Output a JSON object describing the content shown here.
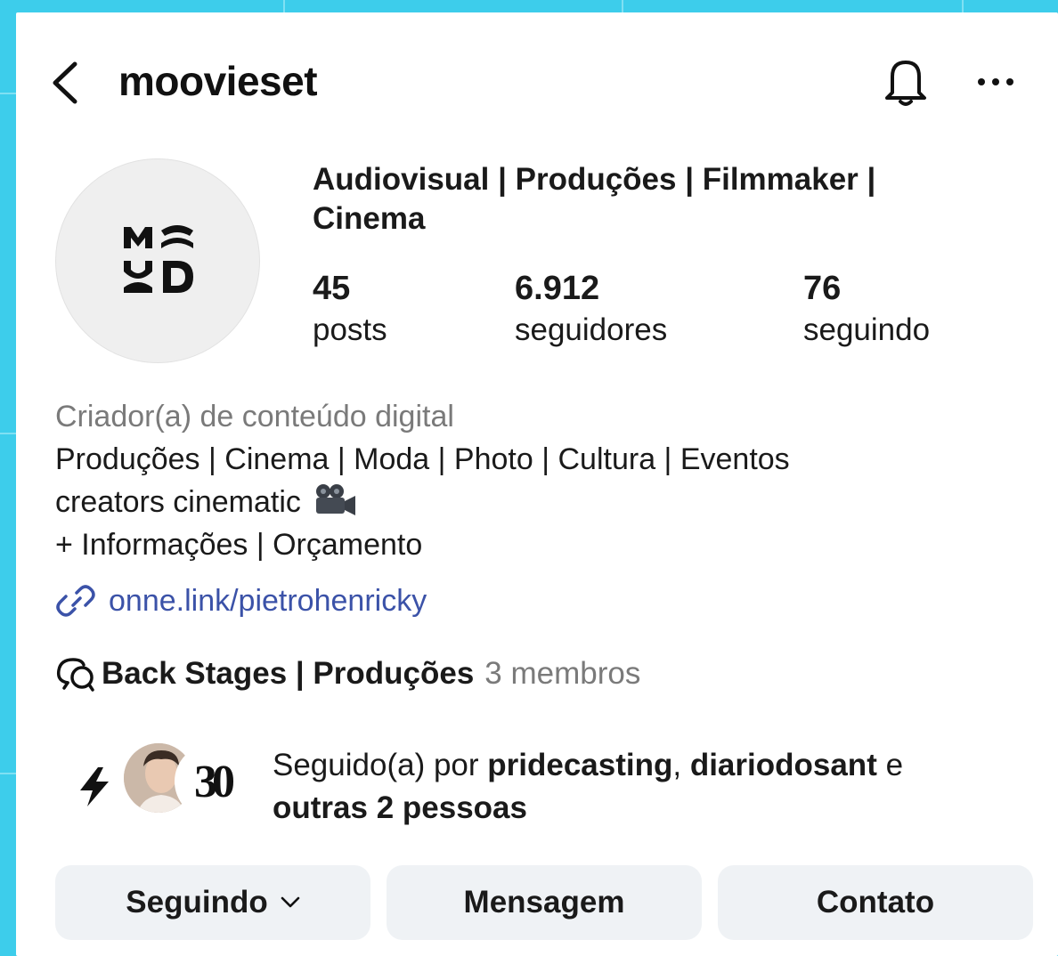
{
  "header": {
    "username": "moovieset"
  },
  "profile": {
    "category_title": "Audiovisual | Produções | Filmmaker | Cinema",
    "stats": [
      {
        "value": "45",
        "label": "posts"
      },
      {
        "value": "6.912",
        "label": "seguidores"
      },
      {
        "value": "76",
        "label": "seguindo"
      }
    ]
  },
  "bio": {
    "category": "Criador(a) de conteúdo digital",
    "line1": "Produções | Cinema | Moda | Photo | Cultura | Eventos",
    "line2": "creators cinematic",
    "line3": "+ Informações | Orçamento",
    "link": "onne.link/pietrohenricky"
  },
  "channel": {
    "name": "Back Stages | Produções",
    "members": "3 membros"
  },
  "followed_by": {
    "prefix": "Seguido(a) por ",
    "user1": "pridecasting",
    "sep": ", ",
    "user2": "diariodosant",
    "suffix": " e",
    "others": "outras 2 pessoas",
    "avatar2_text": "30"
  },
  "buttons": {
    "following": "Seguindo",
    "message": "Mensagem",
    "contact": "Contato"
  },
  "colors": {
    "background": "#3dcdeb",
    "link": "#3b52a8",
    "button_bg": "#eff2f5"
  },
  "icons": [
    "back-arrow-icon",
    "bell-icon",
    "more-icon",
    "link-icon",
    "channel-icon",
    "bolt-icon",
    "camera-icon",
    "chevron-down-icon"
  ]
}
